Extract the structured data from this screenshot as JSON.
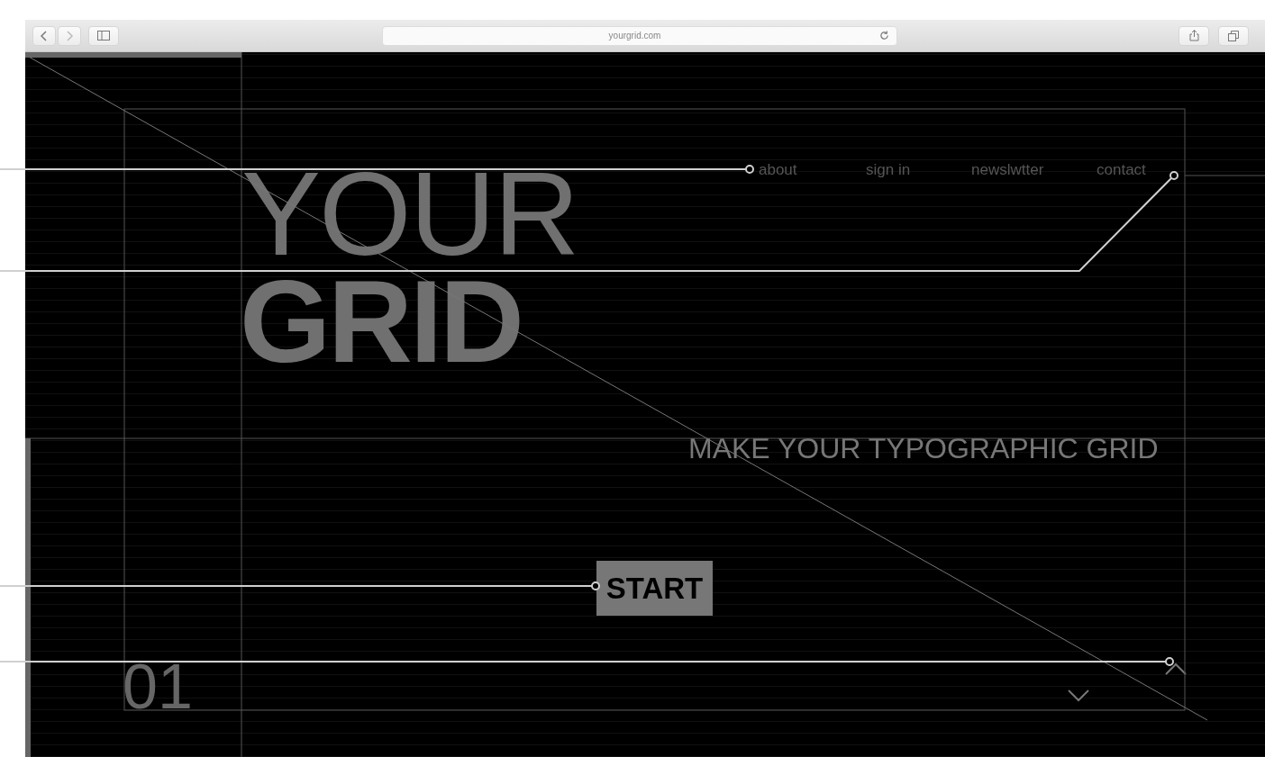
{
  "browser": {
    "address": "yourgrid.com"
  },
  "nav": [
    {
      "label": "about"
    },
    {
      "label": "sign in"
    },
    {
      "label": "newslwtter"
    },
    {
      "label": "contact"
    }
  ],
  "hero": {
    "title_light": "YOUR",
    "title_bold": "GRID",
    "tagline": "MAKE YOUR TYPOGRAPHIC GRID",
    "button": "START",
    "counter": "01"
  }
}
